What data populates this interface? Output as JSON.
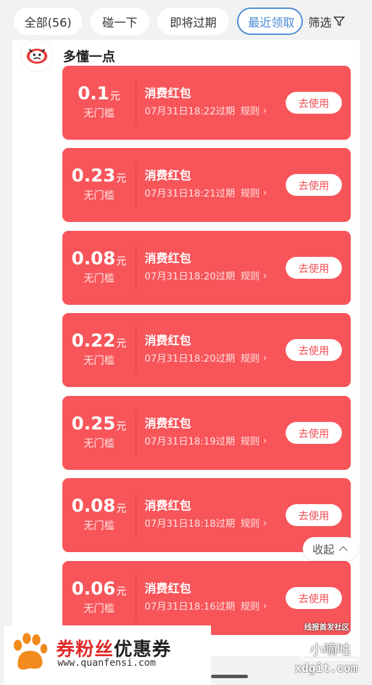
{
  "tabs": [
    {
      "label": "全部(56)",
      "active": false
    },
    {
      "label": "碰一下",
      "active": false
    },
    {
      "label": "即将过期",
      "active": false
    },
    {
      "label": "最近领取",
      "active": true
    }
  ],
  "filter_label": "筛选",
  "shop_name": "多懂一点",
  "coupons": [
    {
      "amount": "0.1",
      "unit": "元",
      "condition": "无门槛",
      "title": "消费红包",
      "expiry": "07月31日18:22过期",
      "rule": "规则",
      "action": "去使用"
    },
    {
      "amount": "0.23",
      "unit": "元",
      "condition": "无门槛",
      "title": "消费红包",
      "expiry": "07月31日18:21过期",
      "rule": "规则",
      "action": "去使用"
    },
    {
      "amount": "0.08",
      "unit": "元",
      "condition": "无门槛",
      "title": "消费红包",
      "expiry": "07月31日18:20过期",
      "rule": "规则",
      "action": "去使用"
    },
    {
      "amount": "0.22",
      "unit": "元",
      "condition": "无门槛",
      "title": "消费红包",
      "expiry": "07月31日18:20过期",
      "rule": "规则",
      "action": "去使用"
    },
    {
      "amount": "0.25",
      "unit": "元",
      "condition": "无门槛",
      "title": "消费红包",
      "expiry": "07月31日18:19过期",
      "rule": "规则",
      "action": "去使用"
    },
    {
      "amount": "0.08",
      "unit": "元",
      "condition": "无门槛",
      "title": "消费红包",
      "expiry": "07月31日18:18过期",
      "rule": "规则",
      "action": "去使用"
    },
    {
      "amount": "0.06",
      "unit": "元",
      "condition": "无门槛",
      "title": "消费红包",
      "expiry": "07月31日18:16过期",
      "rule": "规则",
      "action": "去使用"
    }
  ],
  "collapse_label": "收起",
  "watermark": {
    "brand_part1": "券粉丝",
    "brand_part2": "优惠券",
    "url": "www.quanfensi.com",
    "forum_tag": "线报首发社区",
    "forum_logo": "小嘀咕",
    "forum_url": "xdgit.com"
  },
  "colors": {
    "coupon": "#f7555a",
    "accent": "#4a8bd6",
    "brand_red": "#e02a2a"
  },
  "icons": [
    "filter-funnel-icon",
    "chevron-right-icon",
    "chevron-up-icon",
    "paw-logo-icon"
  ]
}
